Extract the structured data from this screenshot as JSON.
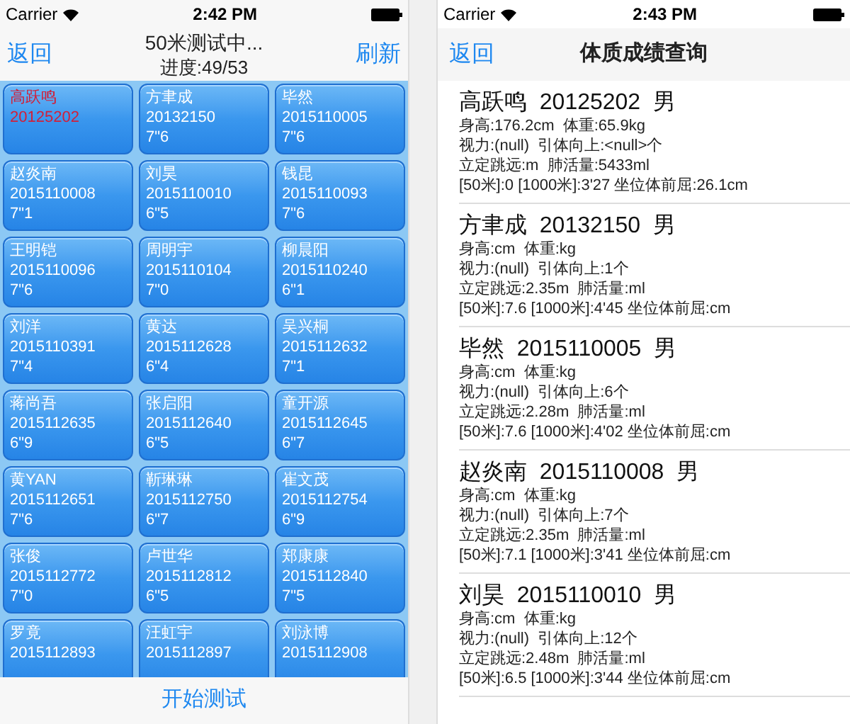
{
  "left": {
    "status_bar": {
      "carrier": "Carrier",
      "time": "2:42 PM"
    },
    "nav": {
      "back": "返回",
      "title": "50米测试中...",
      "progress": "进度:49/53",
      "refresh": "刷新"
    },
    "students": [
      {
        "name": "高跃鸣",
        "id": "20125202",
        "selected": true
      },
      {
        "name": "方聿成",
        "id": "20132150",
        "time": "7\"6",
        "selected": false
      },
      {
        "name": "毕然",
        "id": "2015110005",
        "time": "7\"6",
        "selected": false
      },
      {
        "name": "赵炎南",
        "id": "2015110008",
        "time": "7\"1",
        "selected": false
      },
      {
        "name": "刘昊",
        "id": "2015110010",
        "time": "6\"5",
        "selected": false
      },
      {
        "name": "钱昆",
        "id": "2015110093",
        "time": "7\"6",
        "selected": false
      },
      {
        "name": "王明铠",
        "id": "2015110096",
        "time": "7\"6",
        "selected": false
      },
      {
        "name": "周明宇",
        "id": "2015110104",
        "time": "7\"0",
        "selected": false
      },
      {
        "name": "柳晨阳",
        "id": "2015110240",
        "time": "6\"1",
        "selected": false
      },
      {
        "name": "刘洋",
        "id": "2015110391",
        "time": "7\"4",
        "selected": false
      },
      {
        "name": "黄达",
        "id": "2015112628",
        "time": "6\"4",
        "selected": false
      },
      {
        "name": "吴兴桐",
        "id": "2015112632",
        "time": "7\"1",
        "selected": false
      },
      {
        "name": "蒋尚吾",
        "id": "2015112635",
        "time": "6\"9",
        "selected": false
      },
      {
        "name": "张启阳",
        "id": "2015112640",
        "time": "6\"5",
        "selected": false
      },
      {
        "name": "童开源",
        "id": "2015112645",
        "time": "6\"7",
        "selected": false
      },
      {
        "name": "黄YAN",
        "id": "2015112651",
        "time": "7\"6",
        "selected": false
      },
      {
        "name": "靳琳琳",
        "id": "2015112750",
        "time": "6\"7",
        "selected": false
      },
      {
        "name": "崔文茂",
        "id": "2015112754",
        "time": "6\"9",
        "selected": false
      },
      {
        "name": "张俊",
        "id": "2015112772",
        "time": "7\"0",
        "selected": false
      },
      {
        "name": "卢世华",
        "id": "2015112812",
        "time": "6\"5",
        "selected": false
      },
      {
        "name": "郑康康",
        "id": "2015112840",
        "time": "7\"5",
        "selected": false
      },
      {
        "name": "罗竟",
        "id": "2015112893",
        "selected": false
      },
      {
        "name": "汪虹宇",
        "id": "2015112897",
        "selected": false
      },
      {
        "name": "刘泳博",
        "id": "2015112908",
        "selected": false
      }
    ],
    "start_button": "开始测试"
  },
  "right": {
    "status_bar": {
      "carrier": "Carrier",
      "time": "2:43 PM"
    },
    "nav": {
      "back": "返回",
      "title": "体质成绩查询"
    },
    "results": [
      {
        "heading": "高跃鸣  20125202  男",
        "lines": [
          "身高:176.2cm  体重:65.9kg",
          "视力:(null)  引体向上:<null>个",
          "立定跳远:m  肺活量:5433ml",
          "[50米]:0 [1000米]:3'27 坐位体前屈:26.1cm"
        ]
      },
      {
        "heading": "方聿成  20132150  男",
        "lines": [
          "身高:cm  体重:kg",
          "视力:(null)  引体向上:1个",
          "立定跳远:2.35m  肺活量:ml",
          "[50米]:7.6 [1000米]:4'45 坐位体前屈:cm"
        ]
      },
      {
        "heading": "毕然  2015110005  男",
        "lines": [
          "身高:cm  体重:kg",
          "视力:(null)  引体向上:6个",
          "立定跳远:2.28m  肺活量:ml",
          "[50米]:7.6 [1000米]:4'02 坐位体前屈:cm"
        ]
      },
      {
        "heading": "赵炎南  2015110008  男",
        "lines": [
          "身高:cm  体重:kg",
          "视力:(null)  引体向上:7个",
          "立定跳远:2.35m  肺活量:ml",
          "[50米]:7.1 [1000米]:3'41 坐位体前屈:cm"
        ]
      },
      {
        "heading": "刘昊  2015110010  男",
        "lines": [
          "身高:cm  体重:kg",
          "视力:(null)  引体向上:12个",
          "立定跳远:2.48m  肺活量:ml",
          "[50米]:6.5 [1000米]:3'44 坐位体前屈:cm"
        ]
      }
    ]
  }
}
